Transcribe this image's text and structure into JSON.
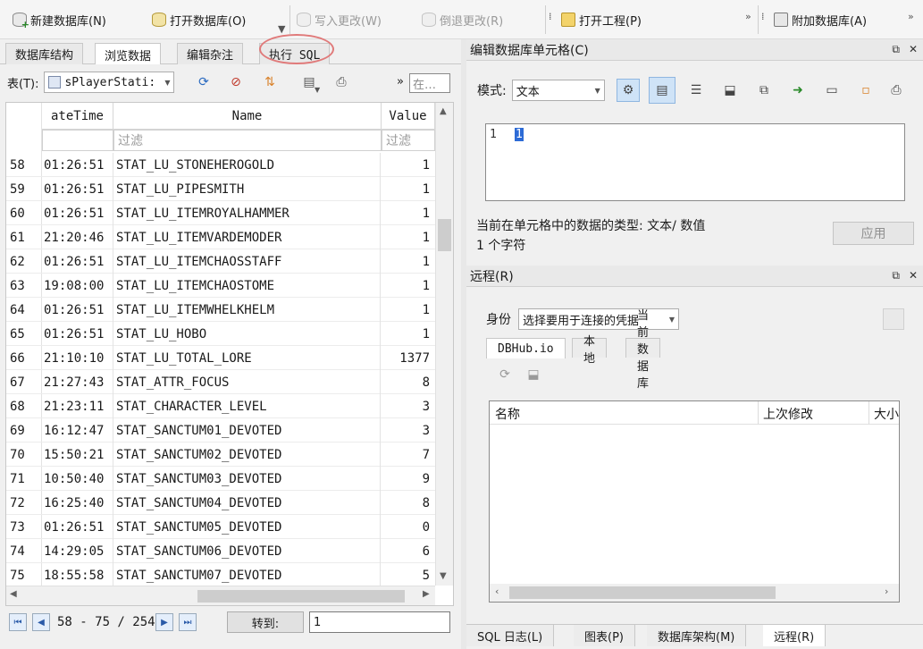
{
  "toolbar": {
    "new_db": "新建数据库(N)",
    "open_db": "打开数据库(O)",
    "write_changes": "写入更改(W)",
    "revert_changes": "倒退更改(R)",
    "open_project": "打开工程(P)",
    "attach_db": "附加数据库(A)"
  },
  "left_tabs": [
    "数据库结构",
    "浏览数据",
    "编辑杂注",
    "执行 SQL"
  ],
  "filterbar": {
    "table_label": "表(T):",
    "table_value": "sPlayerStati:",
    "search_placeholder": "在…"
  },
  "grid": {
    "columns": [
      "ateTime",
      "Name",
      "Value"
    ],
    "filter_placeholder": "过滤",
    "rows": [
      {
        "n": "58",
        "t": "01:26:51",
        "name": "STAT_LU_STONEHEROGOLD",
        "v": "1"
      },
      {
        "n": "59",
        "t": "01:26:51",
        "name": "STAT_LU_PIPESMITH",
        "v": "1"
      },
      {
        "n": "60",
        "t": "01:26:51",
        "name": "STAT_LU_ITEMROYALHAMMER",
        "v": "1"
      },
      {
        "n": "61",
        "t": "21:20:46",
        "name": "STAT_LU_ITEMVARDEMODER",
        "v": "1"
      },
      {
        "n": "62",
        "t": "01:26:51",
        "name": "STAT_LU_ITEMCHAOSSTAFF",
        "v": "1"
      },
      {
        "n": "63",
        "t": "19:08:00",
        "name": "STAT_LU_ITEMCHAOSTOME",
        "v": "1"
      },
      {
        "n": "64",
        "t": "01:26:51",
        "name": "STAT_LU_ITEMWHELKHELM",
        "v": "1"
      },
      {
        "n": "65",
        "t": "01:26:51",
        "name": "STAT_LU_HOBO",
        "v": "1"
      },
      {
        "n": "66",
        "t": "21:10:10",
        "name": "STAT_LU_TOTAL_LORE",
        "v": "1377"
      },
      {
        "n": "67",
        "t": "21:27:43",
        "name": "STAT_ATTR_FOCUS",
        "v": "8"
      },
      {
        "n": "68",
        "t": "21:23:11",
        "name": "STAT_CHARACTER_LEVEL",
        "v": "3"
      },
      {
        "n": "69",
        "t": "16:12:47",
        "name": "STAT_SANCTUM01_DEVOTED",
        "v": "3"
      },
      {
        "n": "70",
        "t": "15:50:21",
        "name": "STAT_SANCTUM02_DEVOTED",
        "v": "7"
      },
      {
        "n": "71",
        "t": "10:50:40",
        "name": "STAT_SANCTUM03_DEVOTED",
        "v": "9"
      },
      {
        "n": "72",
        "t": "16:25:40",
        "name": "STAT_SANCTUM04_DEVOTED",
        "v": "8"
      },
      {
        "n": "73",
        "t": "01:26:51",
        "name": "STAT_SANCTUM05_DEVOTED",
        "v": "0"
      },
      {
        "n": "74",
        "t": "14:29:05",
        "name": "STAT_SANCTUM06_DEVOTED",
        "v": "6"
      },
      {
        "n": "75",
        "t": "18:55:58",
        "name": "STAT_SANCTUM07_DEVOTED",
        "v": "5"
      }
    ]
  },
  "pager": {
    "range_text": "58 - 75 / 254",
    "goto_label": "转到:",
    "goto_value": "1"
  },
  "edit_cell": {
    "title": "编辑数据库单元格(C)",
    "mode_label": "模式:",
    "mode_value": "文本",
    "line_number": "1",
    "value": "1",
    "type_info": "当前在单元格中的数据的类型: 文本/ 数值",
    "size_info": "1 个字符",
    "apply_label": "应用"
  },
  "remote": {
    "title": "远程(R)",
    "identity_label": "身份",
    "identity_value": "选择要用于连接的凭据",
    "tabs": [
      "DBHub.io",
      "本地",
      "当前数据库"
    ],
    "columns": [
      "名称",
      "上次修改",
      "大小"
    ]
  },
  "bottom_tabs": [
    "SQL 日志(L)",
    "图表(P)",
    "数据库架构(M)",
    "远程(R)"
  ],
  "colors": {
    "annotation_circle": "#e07a7a",
    "selection": "#2d6bd6"
  }
}
